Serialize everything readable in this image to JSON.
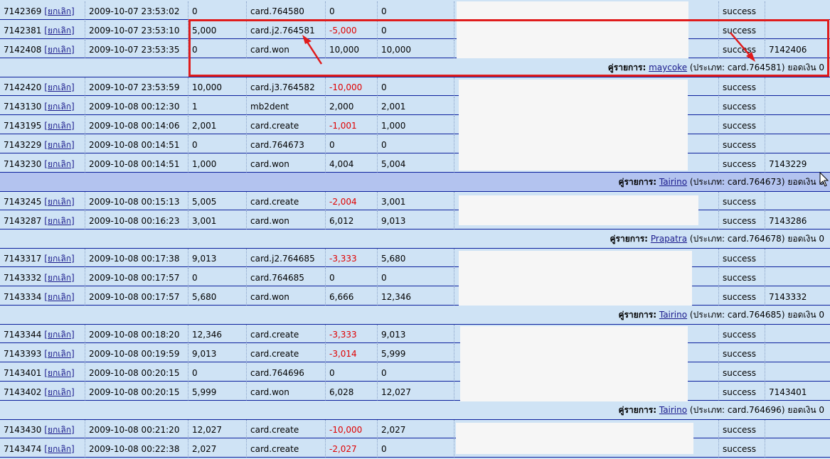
{
  "cancel_label": "ยกเลิก",
  "partner_label": "คู่รายการ:",
  "type_label": "ประเภท:",
  "balance_label": "ยอดเงิน",
  "items": [
    {
      "kind": "row",
      "id": "7142369",
      "time": "2009-10-07 23:53:02",
      "before": "0",
      "action": "card.764580",
      "amount": "0",
      "after": "0",
      "status": "success",
      "ref": "",
      "neg": false
    },
    {
      "kind": "row",
      "id": "7142381",
      "time": "2009-10-07 23:53:10",
      "before": "5,000",
      "action": "card.j2.764581",
      "amount": "-5,000",
      "after": "0",
      "status": "success",
      "ref": "",
      "neg": true
    },
    {
      "kind": "row",
      "id": "7142408",
      "time": "2009-10-07 23:53:35",
      "before": "0",
      "action": "card.won",
      "amount": "10,000",
      "after": "10,000",
      "status": "success",
      "ref": "7142406",
      "neg": false
    },
    {
      "kind": "summary",
      "partner": "maycoke",
      "type": "card.764581",
      "balance": "0",
      "highlight": false
    },
    {
      "kind": "row",
      "id": "7142420",
      "time": "2009-10-07 23:53:59",
      "before": "10,000",
      "action": "card.j3.764582",
      "amount": "-10,000",
      "after": "0",
      "status": "success",
      "ref": "",
      "neg": true
    },
    {
      "kind": "row",
      "id": "7143130",
      "time": "2009-10-08 00:12:30",
      "before": "1",
      "action": "mb2dent",
      "amount": "2,000",
      "after": "2,001",
      "status": "success",
      "ref": "",
      "neg": false
    },
    {
      "kind": "row",
      "id": "7143195",
      "time": "2009-10-08 00:14:06",
      "before": "2,001",
      "action": "card.create",
      "amount": "-1,001",
      "after": "1,000",
      "status": "success",
      "ref": "",
      "neg": true
    },
    {
      "kind": "row",
      "id": "7143229",
      "time": "2009-10-08 00:14:51",
      "before": "0",
      "action": "card.764673",
      "amount": "0",
      "after": "0",
      "status": "success",
      "ref": "",
      "neg": false
    },
    {
      "kind": "row",
      "id": "7143230",
      "time": "2009-10-08 00:14:51",
      "before": "1,000",
      "action": "card.won",
      "amount": "4,004",
      "after": "5,004",
      "status": "success",
      "ref": "7143229",
      "neg": false
    },
    {
      "kind": "summary",
      "partner": "Tairino",
      "type": "card.764673",
      "balance": "0",
      "highlight": true
    },
    {
      "kind": "row",
      "id": "7143245",
      "time": "2009-10-08 00:15:13",
      "before": "5,005",
      "action": "card.create",
      "amount": "-2,004",
      "after": "3,001",
      "status": "success",
      "ref": "",
      "neg": true
    },
    {
      "kind": "row",
      "id": "7143287",
      "time": "2009-10-08 00:16:23",
      "before": "3,001",
      "action": "card.won",
      "amount": "6,012",
      "after": "9,013",
      "status": "success",
      "ref": "7143286",
      "neg": false
    },
    {
      "kind": "summary",
      "partner": "Prapatra",
      "type": "card.764678",
      "balance": "0",
      "highlight": false
    },
    {
      "kind": "row",
      "id": "7143317",
      "time": "2009-10-08 00:17:38",
      "before": "9,013",
      "action": "card.j2.764685",
      "amount": "-3,333",
      "after": "5,680",
      "status": "success",
      "ref": "",
      "neg": true
    },
    {
      "kind": "row",
      "id": "7143332",
      "time": "2009-10-08 00:17:57",
      "before": "0",
      "action": "card.764685",
      "amount": "0",
      "after": "0",
      "status": "success",
      "ref": "",
      "neg": false
    },
    {
      "kind": "row",
      "id": "7143334",
      "time": "2009-10-08 00:17:57",
      "before": "5,680",
      "action": "card.won",
      "amount": "6,666",
      "after": "12,346",
      "status": "success",
      "ref": "7143332",
      "neg": false
    },
    {
      "kind": "summary",
      "partner": "Tairino",
      "type": "card.764685",
      "balance": "0",
      "highlight": false
    },
    {
      "kind": "row",
      "id": "7143344",
      "time": "2009-10-08 00:18:20",
      "before": "12,346",
      "action": "card.create",
      "amount": "-3,333",
      "after": "9,013",
      "status": "success",
      "ref": "",
      "neg": true
    },
    {
      "kind": "row",
      "id": "7143393",
      "time": "2009-10-08 00:19:59",
      "before": "9,013",
      "action": "card.create",
      "amount": "-3,014",
      "after": "5,999",
      "status": "success",
      "ref": "",
      "neg": true
    },
    {
      "kind": "row",
      "id": "7143401",
      "time": "2009-10-08 00:20:15",
      "before": "0",
      "action": "card.764696",
      "amount": "0",
      "after": "0",
      "status": "success",
      "ref": "",
      "neg": false
    },
    {
      "kind": "row",
      "id": "7143402",
      "time": "2009-10-08 00:20:15",
      "before": "5,999",
      "action": "card.won",
      "amount": "6,028",
      "after": "12,027",
      "status": "success",
      "ref": "7143401",
      "neg": false
    },
    {
      "kind": "summary",
      "partner": "Tairino",
      "type": "card.764696",
      "balance": "0",
      "highlight": false
    },
    {
      "kind": "row",
      "id": "7143430",
      "time": "2009-10-08 00:21:20",
      "before": "12,027",
      "action": "card.create",
      "amount": "-10,000",
      "after": "2,027",
      "status": "success",
      "ref": "",
      "neg": true
    },
    {
      "kind": "row",
      "id": "7143474",
      "time": "2009-10-08 00:22:38",
      "before": "2,027",
      "action": "card.create",
      "amount": "-2,027",
      "after": "0",
      "status": "success",
      "ref": "",
      "neg": true
    }
  ]
}
